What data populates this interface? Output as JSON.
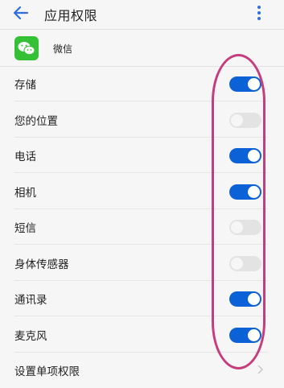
{
  "header": {
    "title": "应用权限",
    "back_icon": "arrow-left-icon",
    "menu_icon": "more-vertical-icon"
  },
  "app": {
    "name": "微信",
    "icon": "wechat-icon",
    "icon_color": "#35c135"
  },
  "permissions": [
    {
      "label": "存储",
      "enabled": true
    },
    {
      "label": "您的位置",
      "enabled": false
    },
    {
      "label": "电话",
      "enabled": true
    },
    {
      "label": "相机",
      "enabled": true
    },
    {
      "label": "短信",
      "enabled": false
    },
    {
      "label": "身体传感器",
      "enabled": false
    },
    {
      "label": "通讯录",
      "enabled": true
    },
    {
      "label": "麦克风",
      "enabled": true
    }
  ],
  "footer_item": {
    "label": "设置单项权限"
  },
  "colors": {
    "accent": "#0a62d6",
    "toggle_off": "#e3e3e3",
    "annotation": "#c63d7e",
    "background": "#f6f6f6"
  }
}
